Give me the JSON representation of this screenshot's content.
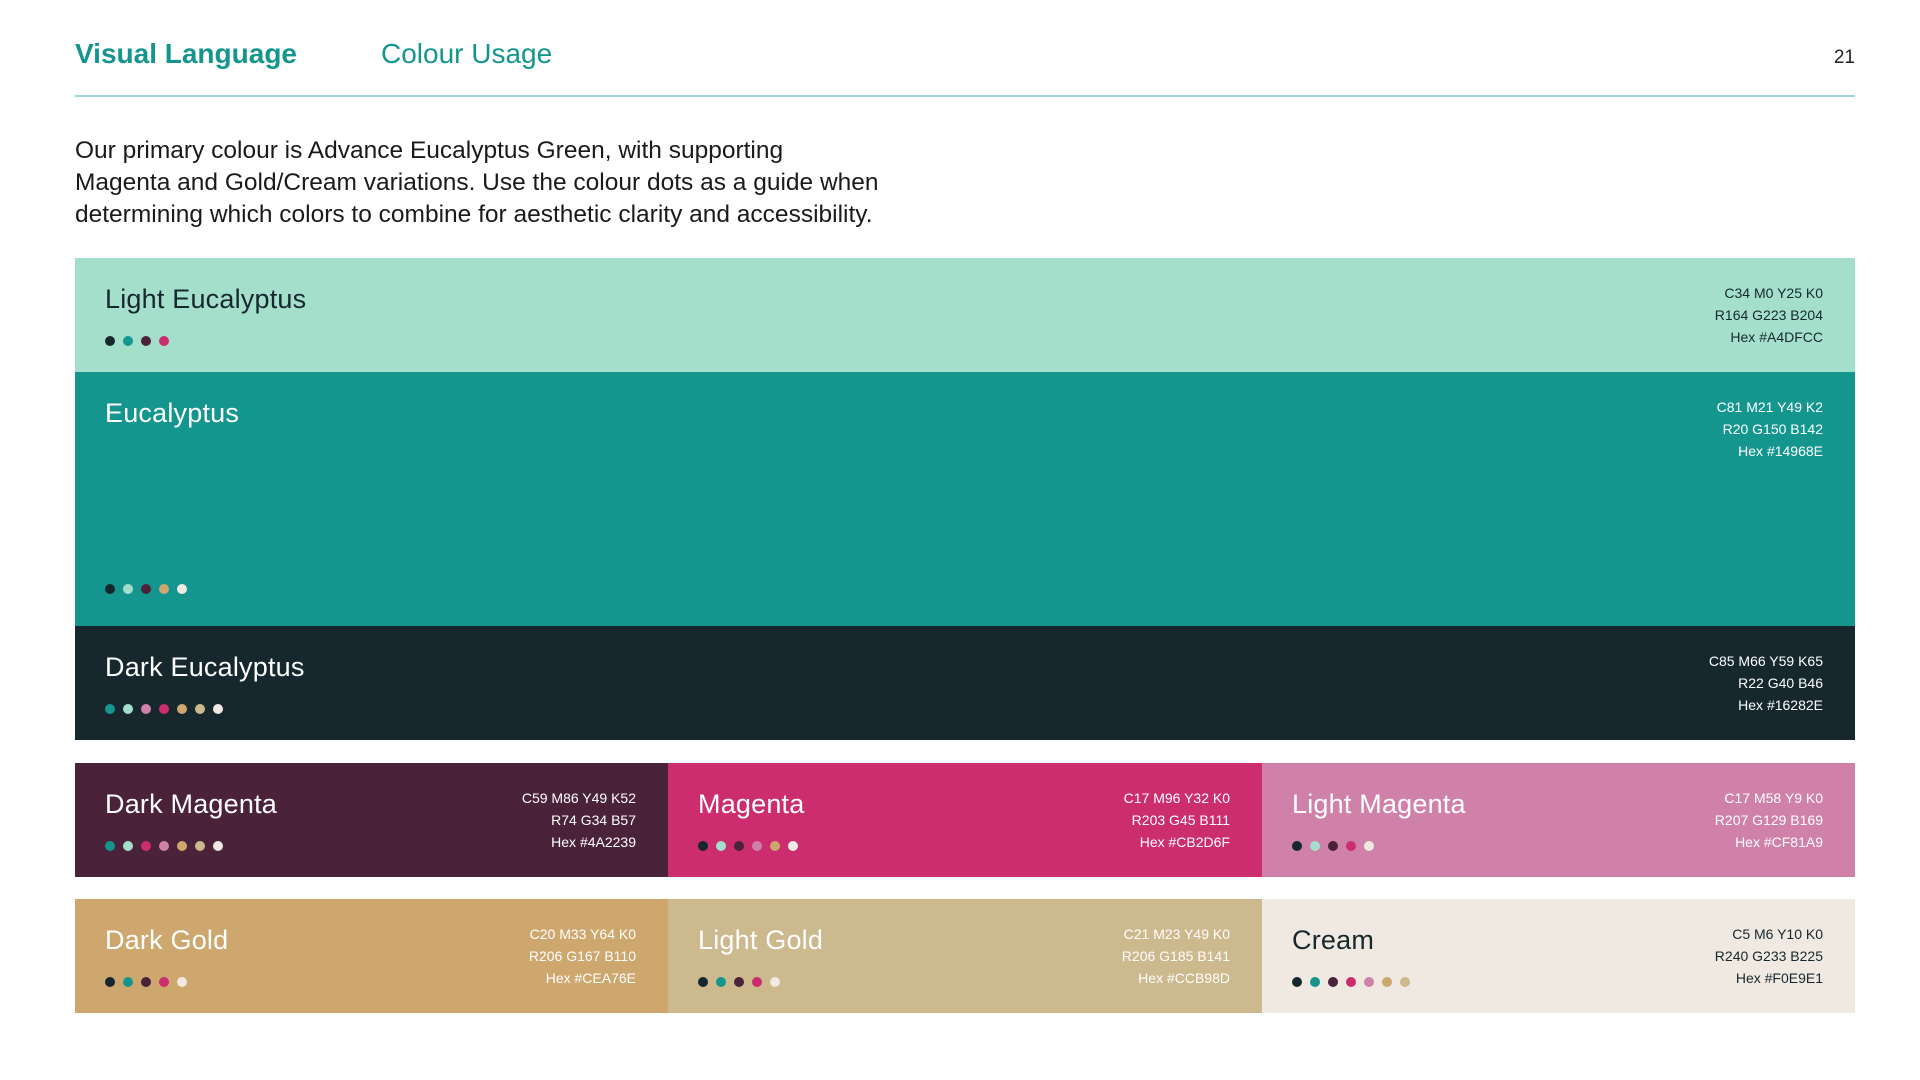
{
  "header": {
    "section": "Visual Language",
    "topic": "Colour Usage",
    "page_number": "21"
  },
  "intro": {
    "line1": "Our primary colour is Advance Eucalyptus Green, with supporting",
    "line2": "Magenta and Gold/Cream variations. Use the colour dots as a guide when",
    "line3": "determining which colors to combine for aesthetic clarity and accessibility."
  },
  "swatches": {
    "light_eucalyptus": {
      "name": "Light Eucalyptus",
      "cmyk": "C34 M0 Y25 K0",
      "rgb": "R164 G223 B204",
      "hex": "Hex #A4DFCC",
      "color": "#A4DFCC",
      "text_color": "#16282E",
      "dots": [
        "#16282E",
        "#14968E",
        "#4A2239",
        "#CB2D6F"
      ]
    },
    "eucalyptus": {
      "name": "Eucalyptus",
      "cmyk": "C81 M21 Y49 K2",
      "rgb": "R20 G150 B142",
      "hex": "Hex #14968E",
      "color": "#14968E",
      "text_color": "#FFFFFF",
      "dots": [
        "#16282E",
        "#A4DFCC",
        "#4A2239",
        "#CEA76E",
        "#F0E9E1"
      ]
    },
    "dark_eucalyptus": {
      "name": "Dark Eucalyptus",
      "cmyk": "C85 M66 Y59 K65",
      "rgb": "R22 G40 B46",
      "hex": "Hex #16282E",
      "color": "#16282E",
      "text_color": "#FFFFFF",
      "dots": [
        "#14968E",
        "#A4DFCC",
        "#CF81A9",
        "#CB2D6F",
        "#CEA76E",
        "#CCB98D",
        "#F0E9E1"
      ]
    },
    "dark_magenta": {
      "name": "Dark Magenta",
      "cmyk": "C59 M86 Y49 K52",
      "rgb": "R74 G34 B57",
      "hex": "Hex #4A2239",
      "color": "#4A2239",
      "text_color": "#FFFFFF",
      "dots": [
        "#14968E",
        "#A4DFCC",
        "#CB2D6F",
        "#CF81A9",
        "#CEA76E",
        "#CCB98D",
        "#F0E9E1"
      ]
    },
    "magenta": {
      "name": "Magenta",
      "cmyk": "C17 M96 Y32 K0",
      "rgb": "R203 G45 B111",
      "hex": "Hex #CB2D6F",
      "color": "#CB2D6F",
      "text_color": "#FFFFFF",
      "dots": [
        "#16282E",
        "#A4DFCC",
        "#4A2239",
        "#CF81A9",
        "#CEA76E",
        "#F0E9E1"
      ]
    },
    "light_magenta": {
      "name": "Light Magenta",
      "cmyk": "C17 M58 Y9 K0",
      "rgb": "R207 G129 B169",
      "hex": "Hex #CF81A9",
      "color": "#CF81A9",
      "text_color": "#FFFFFF",
      "dots": [
        "#16282E",
        "#A4DFCC",
        "#4A2239",
        "#CB2D6F",
        "#F0E9E1"
      ]
    },
    "dark_gold": {
      "name": "Dark Gold",
      "cmyk": "C20 M33 Y64 K0",
      "rgb": "R206 G167 B110",
      "hex": "Hex #CEA76E",
      "color": "#CEA76E",
      "text_color": "#FFFFFF",
      "dots": [
        "#16282E",
        "#14968E",
        "#4A2239",
        "#CB2D6F",
        "#F0E9E1"
      ]
    },
    "light_gold": {
      "name": "Light Gold",
      "cmyk": "C21 M23 Y49 K0",
      "rgb": "R206 G185 B141",
      "hex": "Hex #CCB98D",
      "color": "#CCB98D",
      "text_color": "#FFFFFF",
      "dots": [
        "#16282E",
        "#14968E",
        "#4A2239",
        "#CB2D6F",
        "#F0E9E1"
      ]
    },
    "cream": {
      "name": "Cream",
      "cmyk": "C5 M6 Y10 K0",
      "rgb": "R240 G233 B225",
      "hex": "Hex #F0E9E1",
      "color": "#F0E9E1",
      "text_color": "#16282E",
      "dots": [
        "#16282E",
        "#14968E",
        "#4A2239",
        "#CB2D6F",
        "#CF81A9",
        "#CEA76E",
        "#CCB98D"
      ]
    }
  }
}
